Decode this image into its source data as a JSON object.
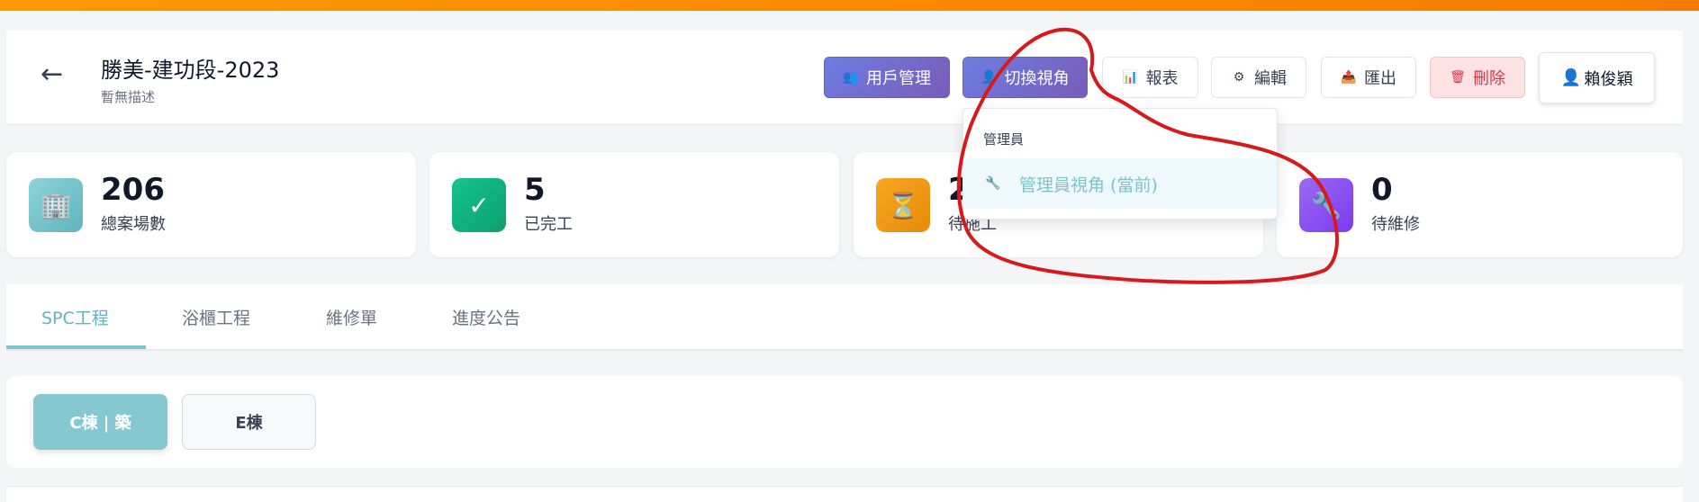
{
  "header": {
    "back_icon": "←",
    "title": "勝美-建功段-2023",
    "description": "暫無描述"
  },
  "toolbar": {
    "user_mgmt": {
      "icon": "👥",
      "label": "用戶管理"
    },
    "switch_view": {
      "icon": "👤",
      "label": "切換視角"
    },
    "reports": {
      "icon": "📊",
      "label": "報表"
    },
    "edit": {
      "icon": "⚙",
      "label": "編輯"
    },
    "export": {
      "icon": "📤",
      "label": "匯出"
    },
    "delete": {
      "icon": "🗑",
      "label": "刪除"
    },
    "user": {
      "icon": "👤",
      "label": "賴俊穎"
    }
  },
  "view_dropdown": {
    "group_label": "管理員",
    "items": [
      {
        "icon": "🔧",
        "label": "管理員視角 (當前)"
      }
    ]
  },
  "stats": [
    {
      "icon": "🏢",
      "value": "206",
      "label": "總案場數",
      "color": "#7cc3cc"
    },
    {
      "icon": "✓",
      "value": "5",
      "label": "已完工",
      "color": "#10b981"
    },
    {
      "icon": "⏳",
      "value": "2",
      "label": "待施工",
      "color": "#f59e0b"
    },
    {
      "icon": "🔧",
      "value": "0",
      "label": "待維修",
      "color": "#8b5cf6"
    }
  ],
  "tabs": [
    {
      "label": "SPC工程",
      "active": true
    },
    {
      "label": "浴櫃工程",
      "active": false
    },
    {
      "label": "維修單",
      "active": false
    },
    {
      "label": "進度公告",
      "active": false
    }
  ],
  "buildings": [
    {
      "label": "C棟 | 築",
      "active": true
    },
    {
      "label": "E棟",
      "active": false
    }
  ],
  "colors": {
    "accent": "#7cc7cf",
    "primary_gradient_start": "#6c7ee1",
    "primary_gradient_end": "#7a5bb8",
    "danger": "#dc3545",
    "annotation": "#d7191c",
    "top_banner": "#ff9800"
  }
}
